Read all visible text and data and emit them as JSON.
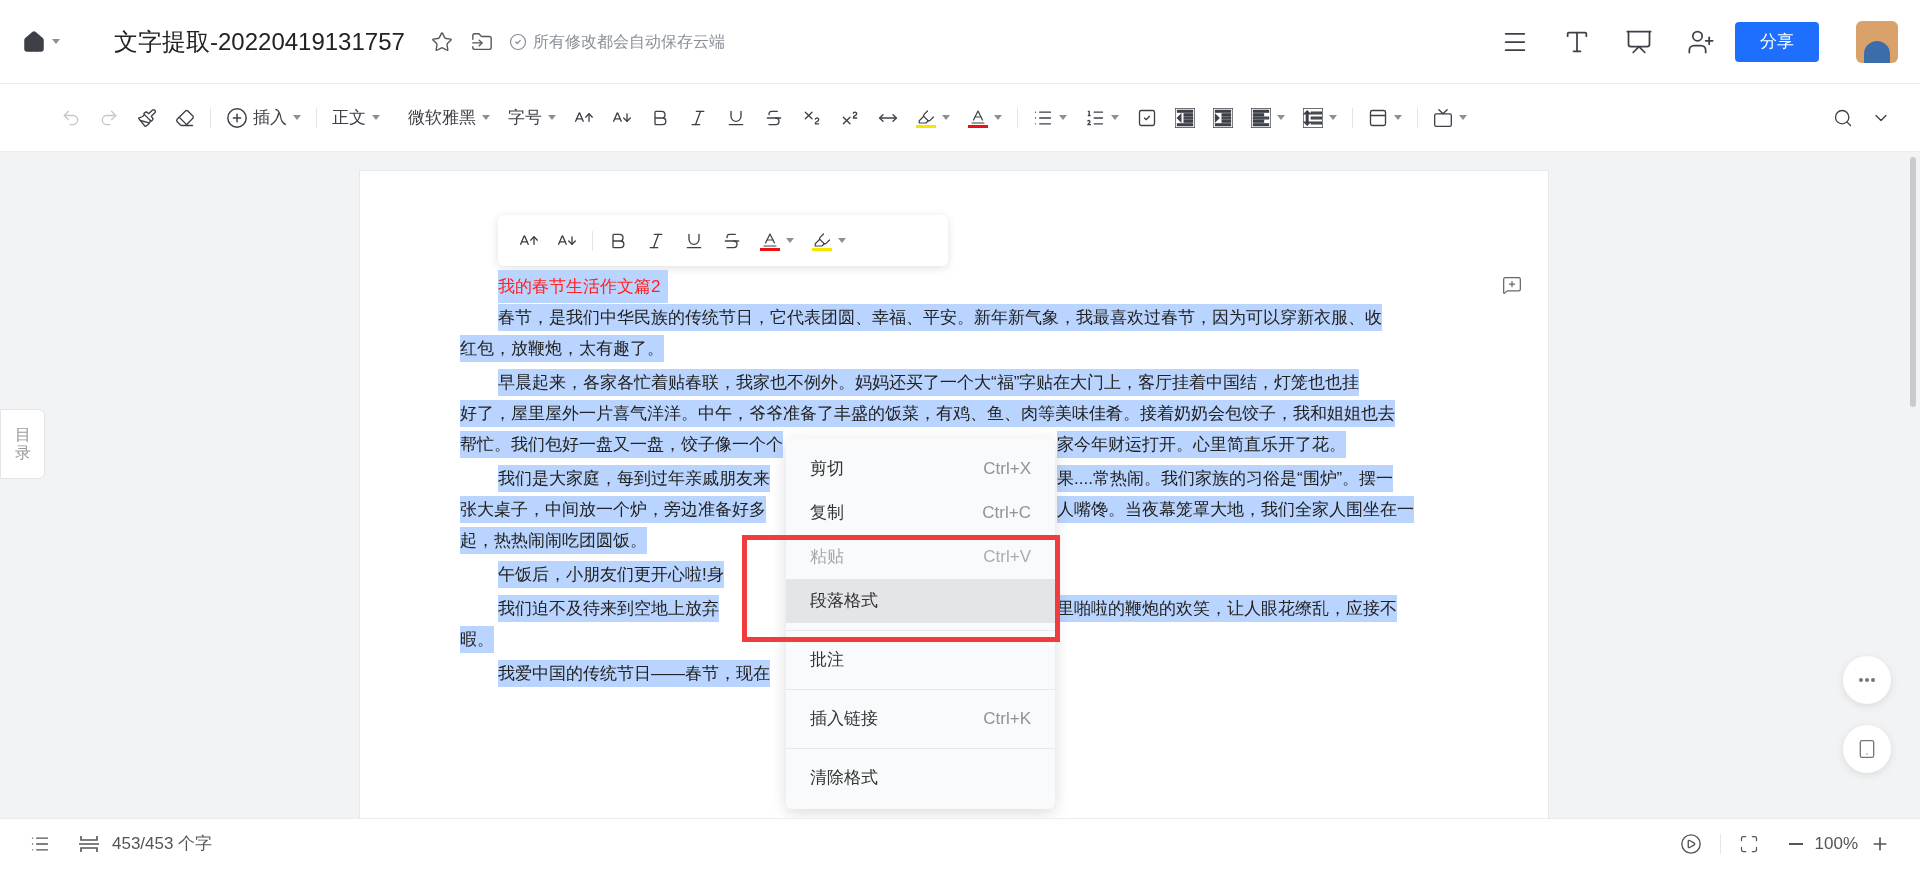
{
  "header": {
    "title": "文字提取-20220419131757",
    "starred": false,
    "save_status": "所有修改都会自动保存云端",
    "share_button": "分享"
  },
  "toolbar": {
    "undo_disabled": true,
    "redo_disabled": true,
    "insert_label": "插入",
    "style_dropdown": "正文",
    "font_dropdown": "微软雅黑",
    "size_dropdown": "字号"
  },
  "side_tab": "目录",
  "document": {
    "title": {
      "text": "我的春节生活作文篇2",
      "selected": true
    },
    "paragraphs": [
      {
        "selected": true,
        "lines": [
          {
            "left": "春节，是我们中华民族的传统节日，它代表团圆、幸福、平安。新年新气象，我最喜欢过春节，因为可以穿新衣服、收"
          },
          {
            "left": "红包，放鞭炮，太有趣了。"
          }
        ]
      },
      {
        "selected": true,
        "lines": [
          {
            "left": "早晨起来，各家各忙着贴春联，我家也不例外。妈妈还买了一个大“福”字贴在大门上，客厅挂着中国结，灯笼也也挂"
          },
          {
            "left": "好了，屋里屋外一片喜气洋洋。中午，爷爷准备了丰盛的饭菜，有鸡、鱼、肉等美味佳肴。接着奶奶会包饺子，我和姐姐也去"
          },
          {
            "left": "帮忙。我们包好一盘又一盘，饺子像一个个",
            "right": "家今年财运打开。心里简直乐开了花。"
          }
        ]
      },
      {
        "selected": true,
        "lines": [
          {
            "left": "我们是大家庭，每到过年亲戚朋友来",
            "right": "果....常热闹。我们家族的习俗是“围炉”。摆一"
          },
          {
            "left": "张大桌子，中间放一个炉，旁边准备好多",
            "right": "人嘴馋。当夜幕笼罩大地，我们全家人围坐在一"
          },
          {
            "left": "起，热热闹闹吃团圆饭。"
          }
        ]
      },
      {
        "selected": true,
        "lines": [
          {
            "left": "午饭后，小朋友们更开心啦!身"
          }
        ]
      },
      {
        "selected": true,
        "lines": [
          {
            "left": "我们迫不及待来到空地上放弃",
            "right": "里啪啦的鞭炮的欢笑，让人眼花缭乱，应接不"
          },
          {
            "left": "暇。"
          }
        ]
      },
      {
        "selected": true,
        "lines": [
          {
            "left": "我爱中国的传统节日——春节，现在"
          }
        ]
      }
    ]
  },
  "context_menu": {
    "items": [
      {
        "kind": "item",
        "label": "剪切",
        "shortcut": "Ctrl+X",
        "disabled": false,
        "selected": false
      },
      {
        "kind": "item",
        "label": "复制",
        "shortcut": "Ctrl+C",
        "disabled": false,
        "selected": false
      },
      {
        "kind": "item",
        "label": "粘贴",
        "shortcut": "Ctrl+V",
        "disabled": true,
        "selected": false
      },
      {
        "kind": "item",
        "label": "段落格式",
        "disabled": false,
        "selected": true
      },
      {
        "kind": "separator"
      },
      {
        "kind": "item",
        "label": "批注",
        "disabled": false,
        "selected": false
      },
      {
        "kind": "separator"
      },
      {
        "kind": "item",
        "label": "插入链接",
        "shortcut": "Ctrl+K",
        "disabled": false,
        "selected": false
      },
      {
        "kind": "separator"
      },
      {
        "kind": "item",
        "label": "清除格式",
        "disabled": false,
        "selected": false
      }
    ]
  },
  "status_bar": {
    "word_count": "453/453 个字",
    "zoom": "100%"
  }
}
